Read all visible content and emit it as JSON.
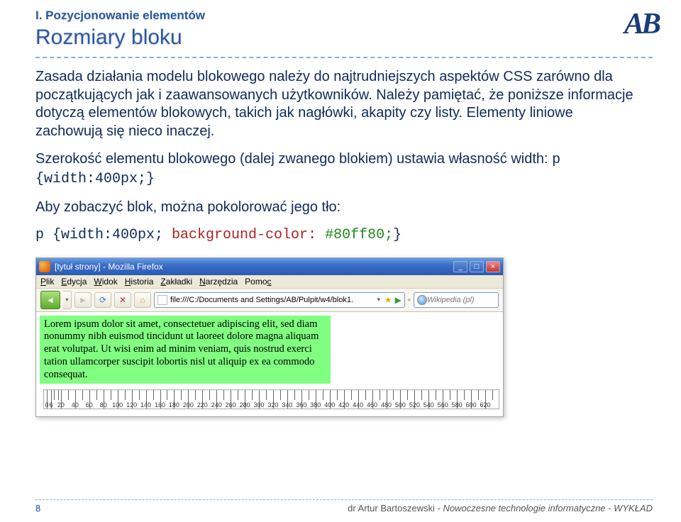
{
  "header": {
    "section_label": "I. Pozycjonowanie elementów",
    "title": "Rozmiary bloku",
    "logo": "AB"
  },
  "body": {
    "para1": "Zasada działania modelu blokowego należy do najtrudniejszych aspektów CSS zarówno dla początkujących jak i zaawansowanych użytkowników. Należy pamiętać, że poniższe informacje dotyczą elementów blokowych, takich jak nagłówki, akapity czy listy. Elementy liniowe zachowują się nieco inaczej.",
    "para2_a": "Szerokość elementu blokowego (dalej zwanego blokiem) ustawia własność width: ",
    "code1": "p {width:400px;}",
    "para3": "Aby zobaczyć blok, można pokolorować jego tło:",
    "code2_a": "p {width:400px; ",
    "code2_b": "background-color:",
    "code2_c": " #80ff80;",
    "code2_d": "}"
  },
  "shot": {
    "window_title": "[tytuł strony] - Mozilla Firefox",
    "menus": [
      "Plik",
      "Edycja",
      "Widok",
      "Historia",
      "Zakładki",
      "Narzędzia",
      "Pomoc"
    ],
    "url": "file:///C:/Documents and Settings/AB/Pulpit/w4/blok1.",
    "search_placeholder": "Wikipedia (pl)",
    "lorem": "Lorem ipsum dolor sit amet, consectetuer adipiscing elit, sed diam nonummy nibh euismod tincidunt ut laoreet dolore magna aliquam erat volutpat. Ut wisi enim ad minim veniam, quis nostrud exerci tation ullamcorper suscipit lobortis nisl ut aliquip ex ea commodo consequat.",
    "ruler_ticks": [
      "0",
      "20",
      "40",
      "60",
      "80",
      "100",
      "120",
      "140",
      "160",
      "180",
      "200",
      "220",
      "240",
      "260",
      "280",
      "300",
      "320",
      "340",
      "360",
      "380",
      "400",
      "420",
      "440",
      "460",
      "480",
      "500",
      "520",
      "540",
      "560",
      "580",
      "600",
      "620",
      "6"
    ]
  },
  "footer": {
    "page": "8",
    "author": "dr Artur Bartoszewski ",
    "rest": "- Nowoczesne technologie  informatyczne - WYKŁAD"
  }
}
